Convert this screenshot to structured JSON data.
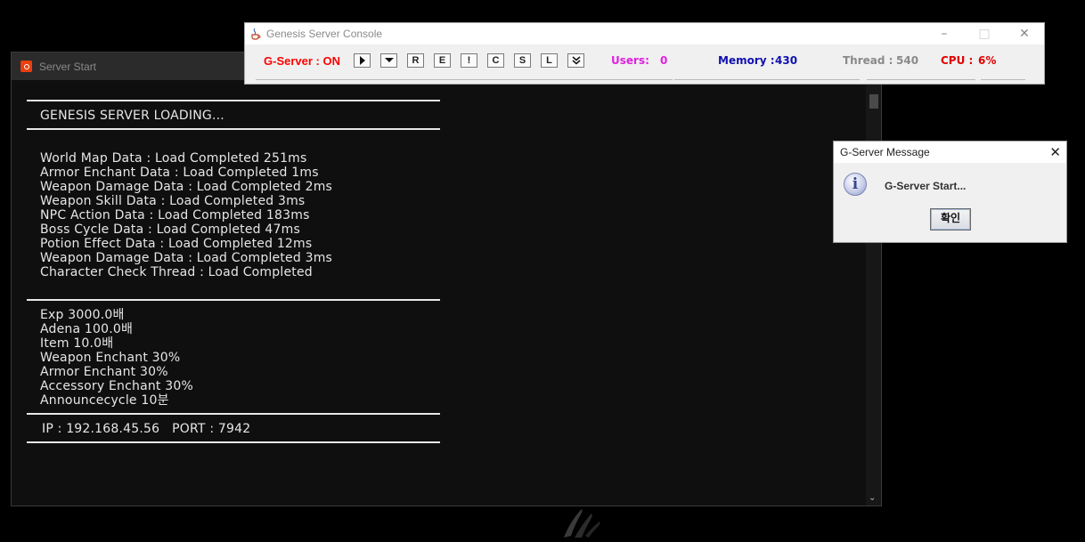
{
  "server_window": {
    "title": "Server Start",
    "console": {
      "loading": "GENESIS SERVER LOADING...",
      "load_lines": [
        "World Map Data : Load Completed 251ms",
        "Armor Enchant Data : Load Completed 1ms",
        "Weapon Damage Data : Load Completed 2ms",
        "Weapon Skill Data : Load Completed 3ms",
        "NPC Action Data : Load Completed 183ms",
        "Boss Cycle Data : Load Completed 47ms",
        "Potion Effect Data : Load Completed 12ms",
        "Weapon Damage Data : Load Completed 3ms",
        "Character Check Thread : Load Completed"
      ],
      "rate_lines": [
        "Exp 3000.0배",
        "Adena 100.0배",
        "Item 10.0배",
        "Weapon Enchant 30%",
        "Armor Enchant 30%",
        "Accessory Enchant 30%",
        "Announcecycle 10분"
      ],
      "ip_port": "IP : 192.168.45.56   PORT : 7942"
    }
  },
  "genesis_console": {
    "title": "Genesis Server Console",
    "status": "G-Server : ON",
    "buttons": [
      {
        "name": "play",
        "label": "",
        "icon": "play-icon"
      },
      {
        "name": "dropdown",
        "label": "",
        "icon": "dropdown-arrow-icon"
      },
      {
        "name": "r",
        "label": "R"
      },
      {
        "name": "e",
        "label": "E"
      },
      {
        "name": "exclaim",
        "label": "!"
      },
      {
        "name": "c",
        "label": "C"
      },
      {
        "name": "s",
        "label": "S"
      },
      {
        "name": "l",
        "label": "L"
      },
      {
        "name": "expand",
        "label": "",
        "icon": "double-chevron-down-icon"
      }
    ],
    "users_label": "Users:",
    "users_value": "0",
    "memory_label": "Memory :",
    "memory_value": "430",
    "thread_label": "Thread :",
    "thread_value": "540",
    "cpu_label": "CPU :",
    "cpu_value": "6%",
    "colors": {
      "status": "#ff0000",
      "users": "#e020e0",
      "memory": "#1010b0",
      "thread": "#8a8a8a",
      "cpu": "#e00000"
    }
  },
  "message_dialog": {
    "title": "G-Server Message",
    "text": "G-Server Start...",
    "ok_label": "확인",
    "icon": "info-icon"
  }
}
